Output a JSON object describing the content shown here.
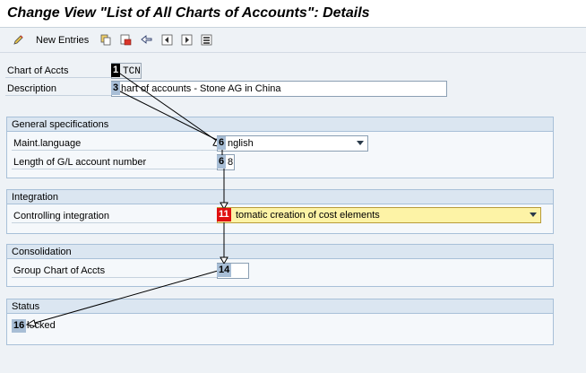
{
  "title": "Change View \"List of All Charts of Accounts\": Details",
  "toolbar": {
    "new_entries_label": "New Entries",
    "icons": [
      "edit-pencil-icon",
      "copy-icon",
      "delete-icon",
      "undo-icon",
      "previous-entry-icon",
      "next-entry-icon",
      "select-block-icon"
    ]
  },
  "header": {
    "chart_label": "Chart of Accts",
    "chart_value": "TCN",
    "description_label": "Description",
    "description_value": "hart of accounts - Stone AG in China"
  },
  "general": {
    "title": "General specifications",
    "maint_label": "Maint.language",
    "maint_value": "nglish",
    "length_label": "Length of G/L account number",
    "length_value": "8"
  },
  "integration": {
    "title": "Integration",
    "controlling_label": "Controlling integration",
    "controlling_value": "tomatic creation of cost elements"
  },
  "consolidation": {
    "title": "Consolidation",
    "group_label": "Group Chart of Accts",
    "group_value": ""
  },
  "status": {
    "title": "Status",
    "value": "locked"
  },
  "badges": {
    "b1": "1",
    "b3": "3",
    "b6a": "6",
    "b6b": "6",
    "b11": "11",
    "b14": "14",
    "b16": "16"
  },
  "colors": {
    "accent_red": "#e01010",
    "highlight_yellow": "#fdf3a6",
    "group_border": "#a8c0d8"
  }
}
